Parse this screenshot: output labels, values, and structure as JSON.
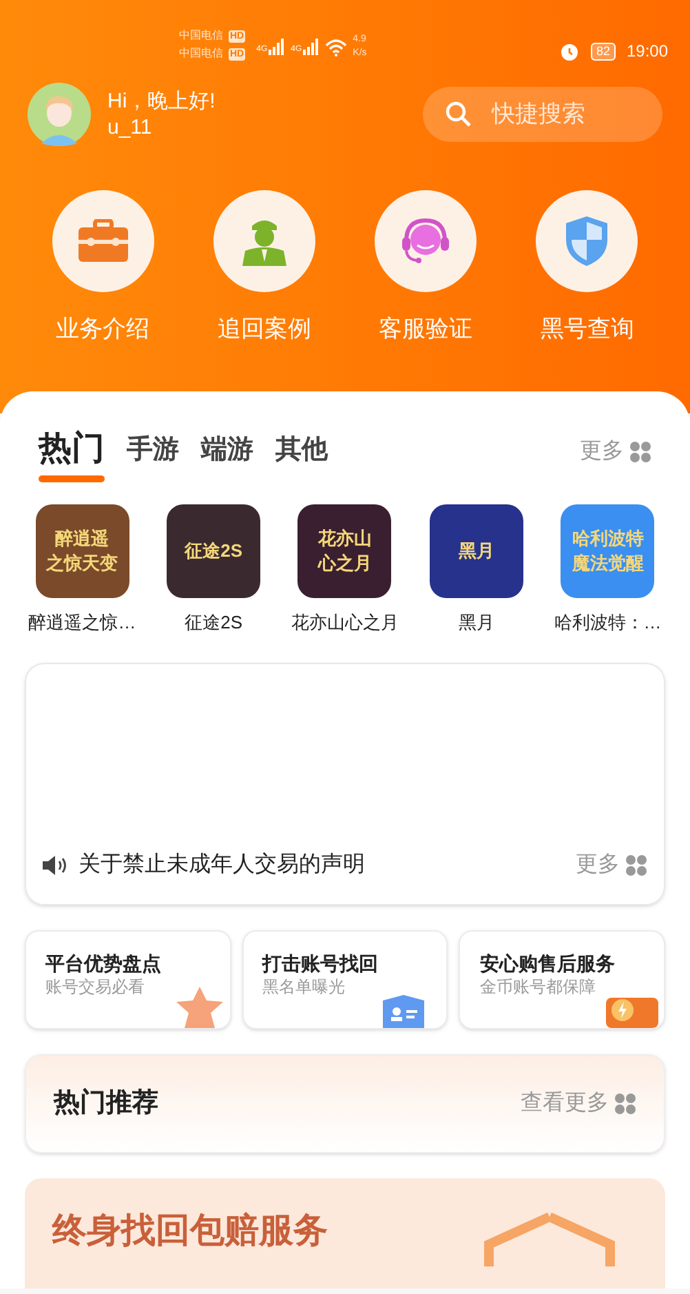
{
  "status_bar": {
    "carriers": [
      {
        "name": "中国电信",
        "badge": "HD"
      },
      {
        "name": "中国电信",
        "badge": "HD"
      }
    ],
    "network_types": [
      "4G",
      "4G"
    ],
    "speed": "4.9",
    "speed_unit": "K/s",
    "battery": "82",
    "time": "19:00"
  },
  "header": {
    "greeting": "Hi，晚上好!",
    "username": "u_11",
    "search": {
      "placeholder": "快捷搜索"
    }
  },
  "shortcuts": [
    {
      "kind": "toolbox",
      "label": "业务介绍"
    },
    {
      "kind": "officer",
      "label": "追回案例"
    },
    {
      "kind": "support",
      "label": "客服验证"
    },
    {
      "kind": "shield",
      "label": "黑号查询"
    }
  ],
  "tabs": [
    {
      "label": "热门",
      "selected": true
    },
    {
      "label": "手游",
      "selected": false
    },
    {
      "label": "端游",
      "selected": false
    },
    {
      "label": "其他",
      "selected": false
    }
  ],
  "tabs_more": "更多",
  "games": [
    {
      "name": "醉逍遥之惊…",
      "logo_lines": [
        "醉逍遥",
        "之惊天变"
      ],
      "color": "#7a4a2a"
    },
    {
      "name": "征途2S",
      "logo_lines": [
        "征途2S"
      ],
      "color": "#3a2a30"
    },
    {
      "name": "花亦山心之月",
      "logo_lines": [
        "花亦山",
        "心之月"
      ],
      "color": "#3a1f30"
    },
    {
      "name": "黑月",
      "logo_lines": [
        "黑月"
      ],
      "color": "#26328c"
    },
    {
      "name": "哈利波特：…",
      "logo_lines": [
        "哈利波特",
        "魔法觉醒"
      ],
      "color": "#3a8ff0"
    }
  ],
  "notice": {
    "text": "关于禁止未成年人交易的声明",
    "more": "更多"
  },
  "feature_cards": [
    {
      "kind": "star",
      "title": "平台优势盘点",
      "subtitle": "账号交易必看"
    },
    {
      "kind": "id",
      "title": "打击账号找回",
      "subtitle": "黑名单曝光"
    },
    {
      "kind": "bolt",
      "title": "安心购售后服务",
      "subtitle": "金币账号都保障"
    }
  ],
  "hot_recommend": {
    "title": "热门推荐",
    "more": "查看更多"
  },
  "promo": {
    "title": "终身找回包赔服务"
  }
}
